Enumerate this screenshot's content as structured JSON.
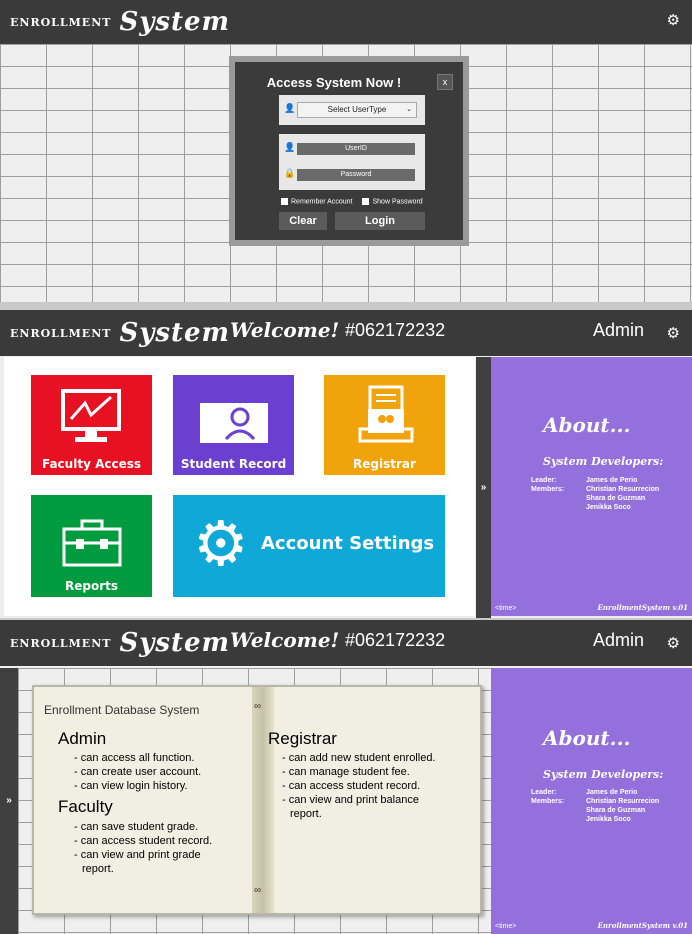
{
  "brand": {
    "small": "ENROLLMENT",
    "big": "System"
  },
  "login": {
    "title": "Access System Now !",
    "close": "x",
    "usertype_placeholder": "Select UserType",
    "userid_placeholder": "UserID",
    "password_placeholder": "Password",
    "remember": "Remember Account",
    "show_password": "Show Password",
    "clear_label": "Clear",
    "login_label": "Login"
  },
  "header": {
    "welcome": "Welcome!",
    "user_id": "#062172232",
    "role": "Admin"
  },
  "tiles": {
    "faculty": "Faculty Access",
    "student": "Student Record",
    "registrar": "Registrar",
    "reports": "Reports",
    "settings": "Account Settings"
  },
  "toggle": "»",
  "about": {
    "title": "About...",
    "subtitle": "System Developers:",
    "leader_label": "Leader:",
    "leader": "James de Perio",
    "members_label": "Members:",
    "members": [
      "Christian Resurrecion",
      "Shara de Guzman",
      "Jenikka Soco"
    ],
    "time": "<time>",
    "version": "EnrollmentSystem v.01"
  },
  "book": {
    "title": "Enrollment Database System",
    "admin": {
      "heading": "Admin",
      "items": [
        "- can access all function.",
        "- can create user account.",
        "- can view login history."
      ]
    },
    "faculty": {
      "heading": "Faculty",
      "items": [
        "- can save student grade.",
        "- can access student record.",
        "- can view and print grade",
        "report."
      ]
    },
    "registrar": {
      "heading": "Registrar",
      "items": [
        "- can add new student enrolled.",
        "- can manage student fee.",
        "- can access student record.",
        "- can view and print balance",
        "report."
      ]
    }
  },
  "colors": {
    "titlebar": "#3a3a3a",
    "faculty": "#e81123",
    "student": "#6b3fd0",
    "registrar": "#f0a30a",
    "reports": "#009b3e",
    "settings": "#10a9d7",
    "about": "#9370db"
  }
}
